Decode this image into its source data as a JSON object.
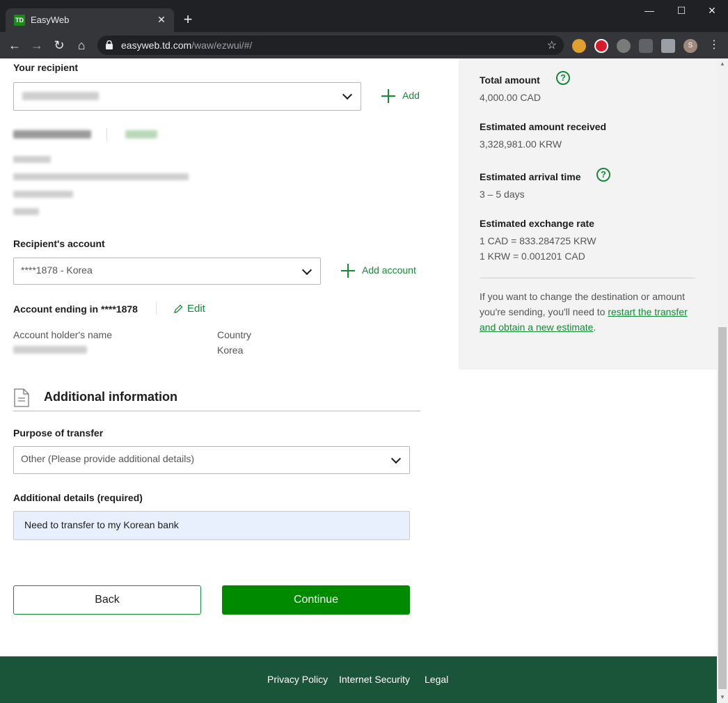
{
  "browser": {
    "tab_title": "EasyWeb",
    "tab_favicon": "TD",
    "url_host": "easyweb.td.com",
    "url_path": "/waw/ezwui/#/",
    "profile_initial": "S"
  },
  "recipient": {
    "section_label": "Your recipient",
    "add_label": "Add"
  },
  "account": {
    "section_label": "Recipient's account",
    "selected": "****1878 - Korea",
    "add_account_label": "Add account",
    "ending_label": "Account ending in ****1878",
    "edit_label": "Edit",
    "holder_name_label": "Account holder's name",
    "country_label": "Country",
    "country_value": "Korea"
  },
  "additional": {
    "heading": "Additional information",
    "purpose_label": "Purpose of transfer",
    "purpose_value": "Other (Please provide additional details)",
    "details_label": "Additional details (required)",
    "details_value": "Need to transfer to my Korean bank"
  },
  "buttons": {
    "back": "Back",
    "continue": "Continue"
  },
  "summary": {
    "total_label": "Total amount",
    "total_value": "4,000.00 CAD",
    "received_label": "Estimated amount received",
    "received_value": "3,328,981.00 KRW",
    "arrival_label": "Estimated arrival time",
    "arrival_value": "3 – 5 days",
    "rate_label": "Estimated exchange rate",
    "rate_line1": "1 CAD = 833.284725 KRW",
    "rate_line2": "1 KRW = 0.001201 CAD",
    "note_prefix": "If you want to change the destination or amount you're sending, you'll need to ",
    "note_link": "restart the transfer and obtain a new estimate",
    "note_suffix": "."
  },
  "footer": {
    "privacy": "Privacy Policy",
    "security": "Internet Security",
    "legal": "Legal"
  },
  "colors": {
    "brand_green": "#008a00",
    "footer_green": "#1b5539",
    "link_green": "#138a36"
  }
}
